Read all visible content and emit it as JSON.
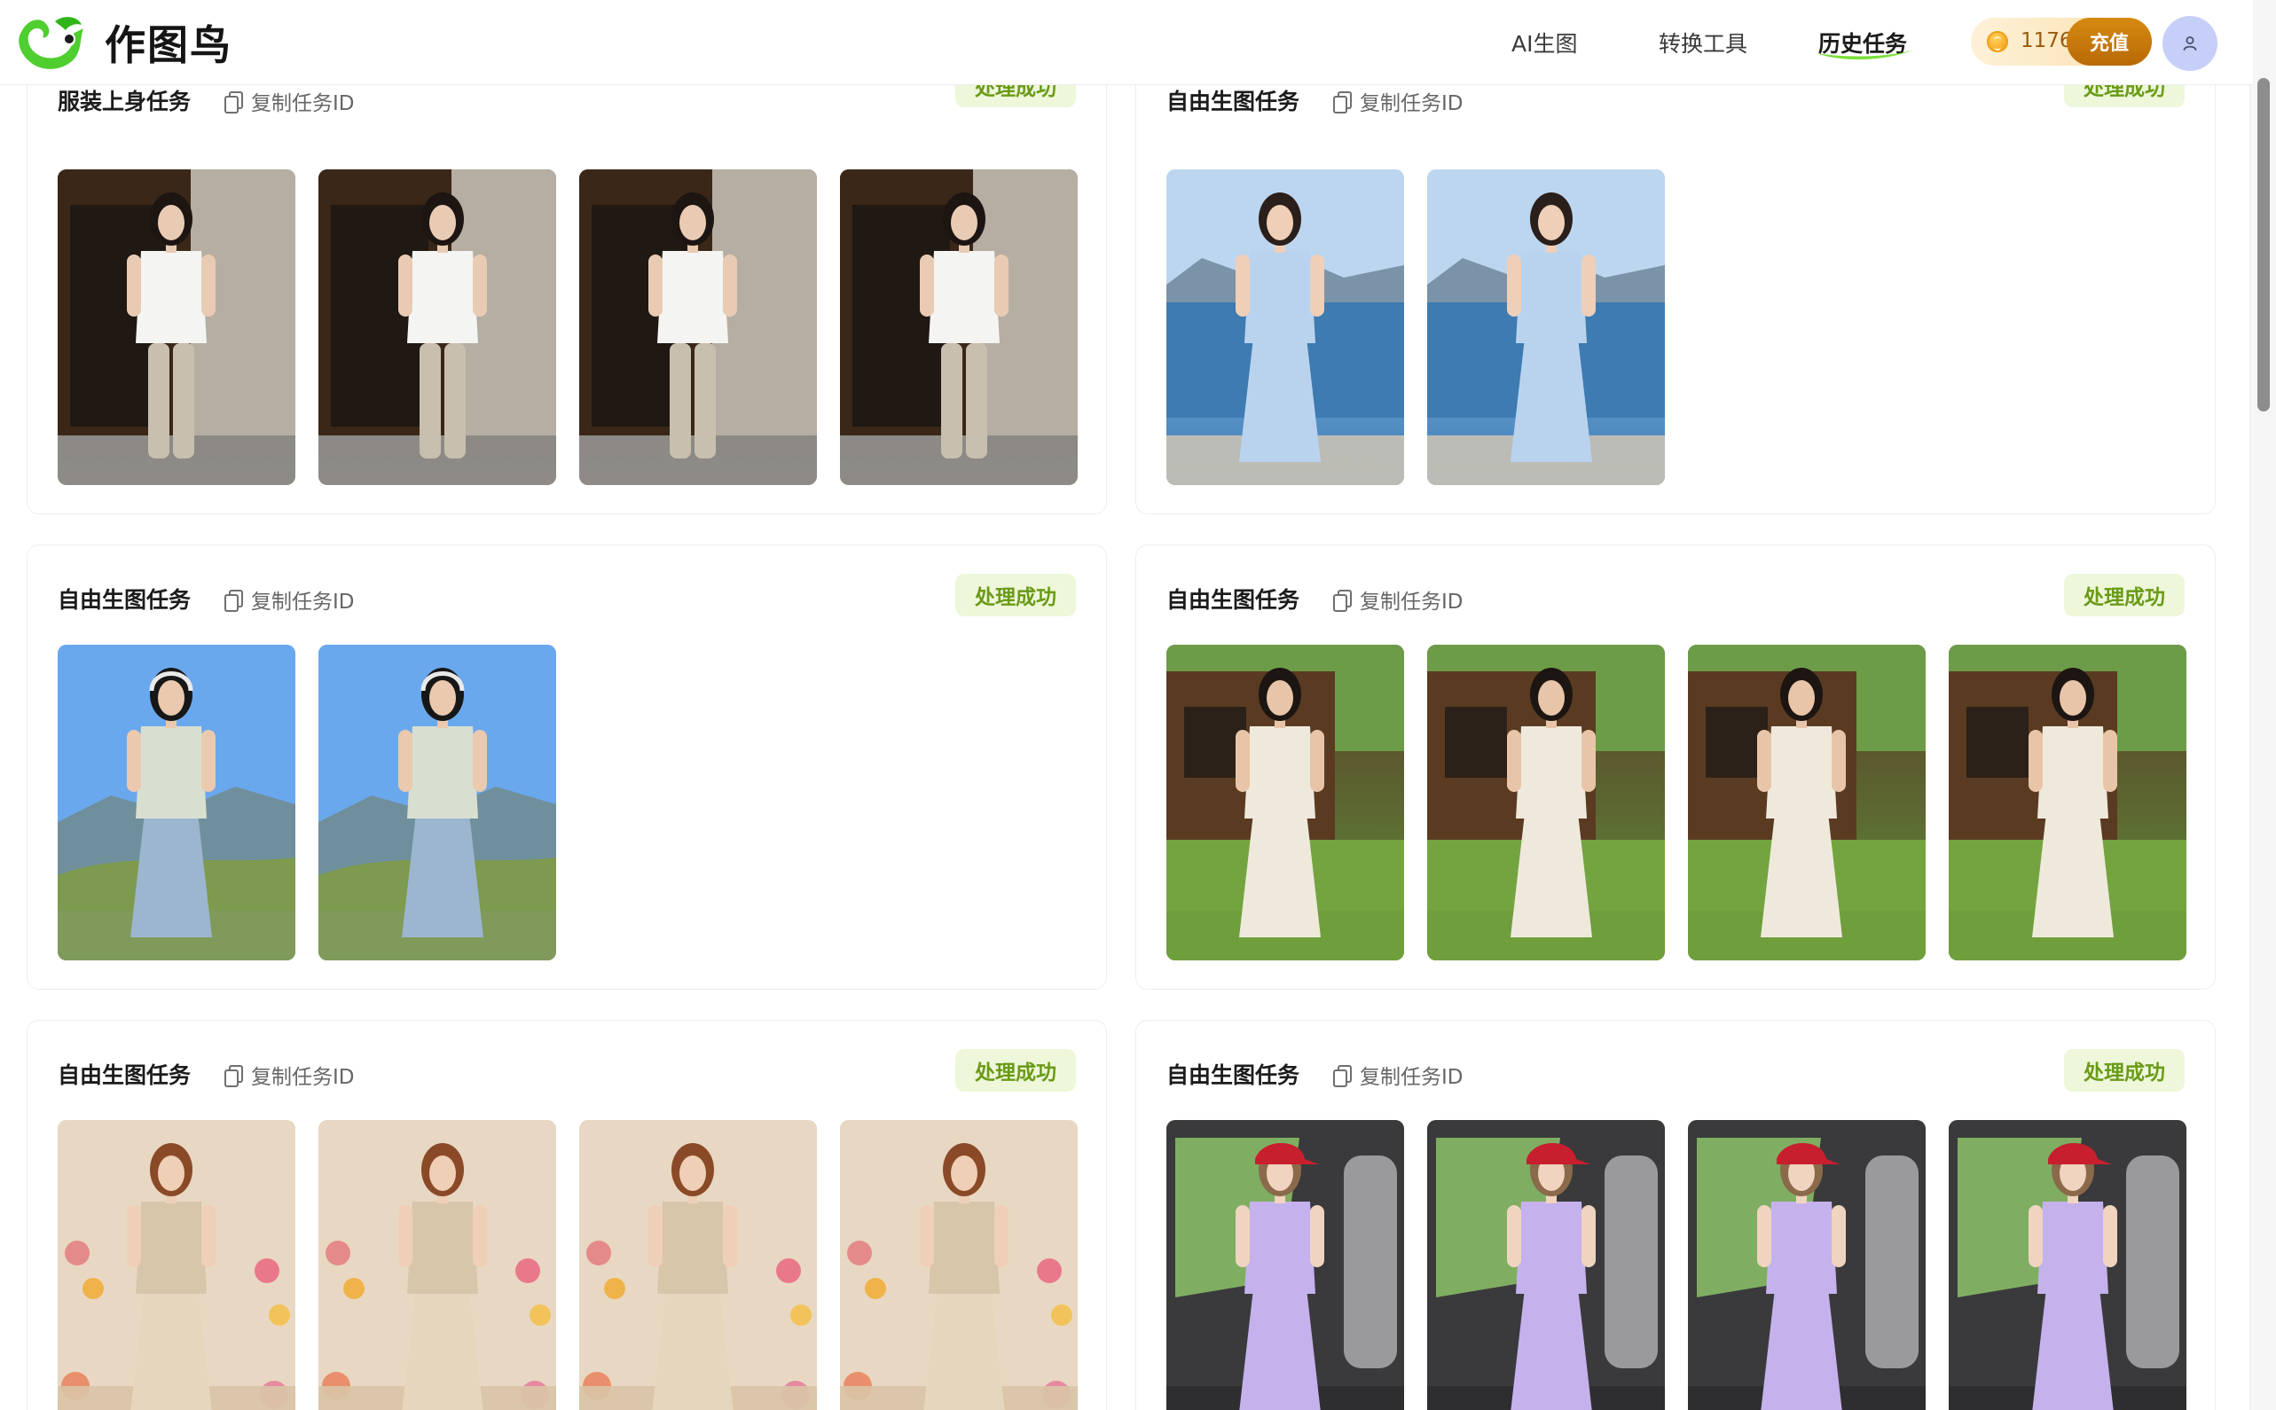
{
  "app": {
    "name": "作图鸟"
  },
  "nav": {
    "items": [
      {
        "label": "AI生图",
        "active": false
      },
      {
        "label": "转换工具",
        "active": false
      },
      {
        "label": "历史任务",
        "active": true
      }
    ]
  },
  "account": {
    "credits": "1176",
    "recharge_label": "充值",
    "coin_icon": "coin-icon",
    "avatar_icon": "user-icon"
  },
  "colors": {
    "brand_green": "#4fce2f",
    "status_bg": "#eef7d9",
    "status_text": "#6a9a18",
    "recharge": "#c47a0b"
  },
  "tasks": [
    {
      "title": "服装上身任务",
      "copy_label": "复制任务ID",
      "status": "处理成功",
      "images": [
        {
          "scene": "wooden door and concrete wall, woman in white t-shirt and beige trousers"
        },
        {
          "scene": "wooden door and concrete wall, woman in white t-shirt and beige trousers"
        },
        {
          "scene": "wooden door and concrete wall, woman in white t-shirt and beige trousers"
        },
        {
          "scene": "wooden door and concrete wall, woman in white t-shirt and beige trousers"
        }
      ]
    },
    {
      "title": "自由生图任务",
      "copy_label": "复制任务ID",
      "status": "处理成功",
      "images": [
        {
          "scene": "seaside promenade, woman in blue floral maxi dress"
        },
        {
          "scene": "seaside promenade, woman in blue floral maxi dress"
        }
      ]
    },
    {
      "title": "自由生图任务",
      "copy_label": "复制任务ID",
      "status": "处理成功",
      "images": [
        {
          "scene": "hillside with blue sky, man in plaid shirt with headphones"
        },
        {
          "scene": "hillside with blue sky, man in plaid shirt with headphones"
        }
      ]
    },
    {
      "title": "自由生图任务",
      "copy_label": "复制任务ID",
      "status": "处理成功",
      "images": [
        {
          "scene": "wooden cabin and lawn, woman in white sleeveless dress with straw bag"
        },
        {
          "scene": "wooden cabin and lawn, woman in white sleeveless dress with straw bag"
        },
        {
          "scene": "wooden cabin and lawn, woman in white sleeveless dress with straw bag"
        },
        {
          "scene": "wooden cabin and lawn, woman in white sleeveless dress with straw bag"
        }
      ]
    },
    {
      "title": "自由生图任务",
      "copy_label": "复制任务ID",
      "status": "处理成功",
      "images": [
        {
          "scene": "studio with flowers, woman in beige dress with headband"
        },
        {
          "scene": "studio with flowers, woman in beige dress with headband"
        },
        {
          "scene": "studio with flowers, woman in beige dress with headband"
        },
        {
          "scene": "studio with flowers, woman in beige dress with headband"
        }
      ]
    },
    {
      "title": "自由生图任务",
      "copy_label": "复制任务ID",
      "status": "处理成功",
      "images": [
        {
          "scene": "car interior, woman in red cap and lavender t-shirt"
        },
        {
          "scene": "car interior, woman in red cap and lavender t-shirt"
        },
        {
          "scene": "car interior, woman in red cap and lavender t-shirt"
        },
        {
          "scene": "car interior, woman in red cap and lavender t-shirt"
        }
      ]
    }
  ]
}
